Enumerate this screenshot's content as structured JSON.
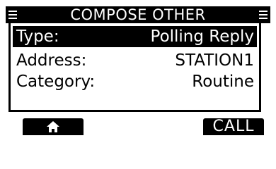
{
  "header": {
    "title": "COMPOSE OTHER",
    "left_icon": "menu-icon",
    "right_icon": "menu-icon"
  },
  "fields": [
    {
      "label": "Type:",
      "value": "Polling Reply",
      "selected": true
    },
    {
      "label": "Address:",
      "value": "STATION1",
      "selected": false
    },
    {
      "label": "Category:",
      "value": "Routine",
      "selected": false
    }
  ],
  "softkeys": {
    "home_icon": "home-icon",
    "call_label": "CALL"
  },
  "colors": {
    "foreground": "#000000",
    "background": "#ffffff"
  }
}
